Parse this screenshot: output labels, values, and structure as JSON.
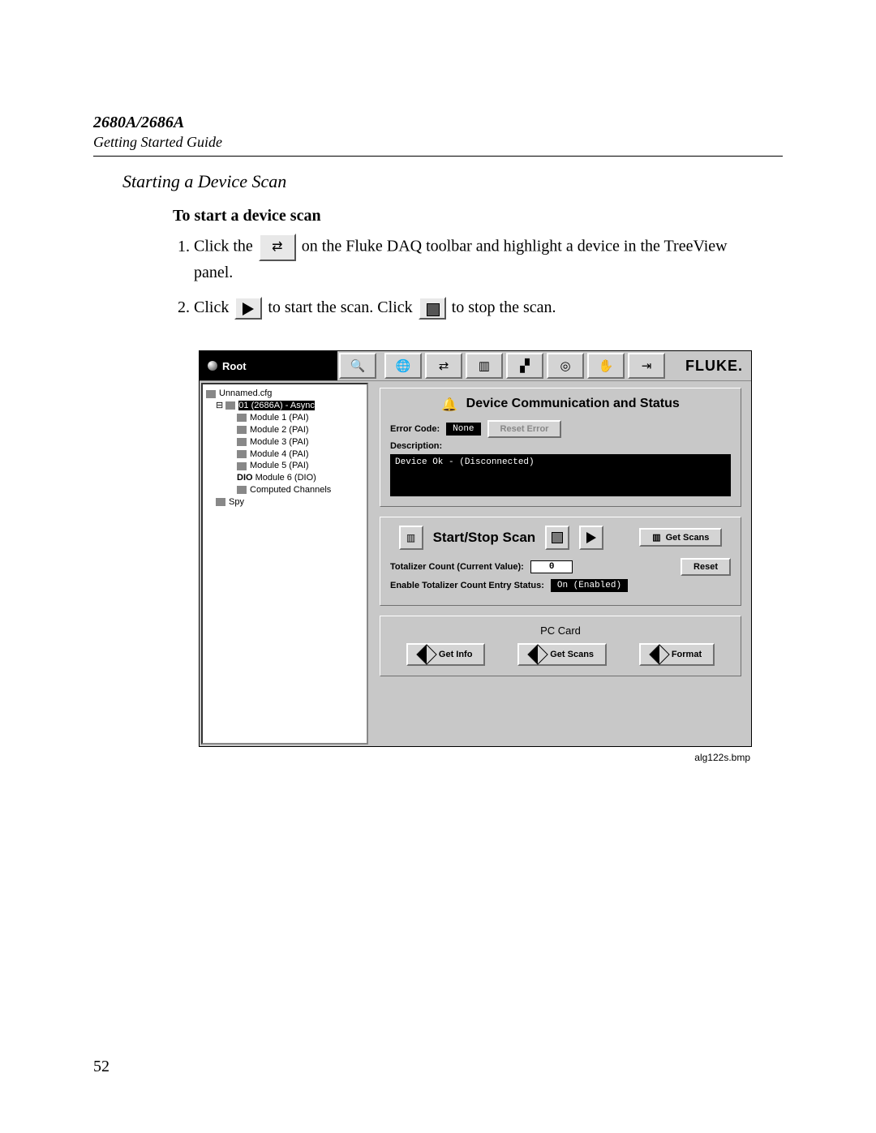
{
  "header": {
    "model": "2680A/2686A",
    "guide": "Getting Started Guide"
  },
  "section_title": "Starting a Device Scan",
  "subheading": "To start a device scan",
  "steps": {
    "s1a": "Click the ",
    "s1b": " on the Fluke DAQ toolbar and highlight a device in the TreeView panel.",
    "s2a": "Click ",
    "s2b": " to start the scan. Click ",
    "s2c": " to stop the scan."
  },
  "app": {
    "root_label": "Root",
    "logo": "FLUKE.",
    "toolbar_icons": [
      "search-icon",
      "globe-icon",
      "communication-icon",
      "device-icon",
      "chart-icon",
      "target-icon",
      "hand-icon",
      "exit-icon"
    ],
    "tree": {
      "cfg": "Unnamed.cfg",
      "dev": "01 (2686A) - Async",
      "modules": [
        "Module 1 (PAI)",
        "Module 2 (PAI)",
        "Module 3 (PAI)",
        "Module 4 (PAI)",
        "Module 5 (PAI)",
        "Module 6 (DIO)"
      ],
      "mod6_prefix": "DIO",
      "computed": "Computed Channels",
      "spy": "Spy"
    },
    "comm": {
      "title": "Device Communication and Status",
      "error_code_label": "Error Code:",
      "error_code_value": "None",
      "reset_error": "Reset Error",
      "description_label": "Description:",
      "description_text": "Device Ok -  (Disconnected)"
    },
    "scan": {
      "title": "Start/Stop Scan",
      "get_scans": "Get Scans",
      "totalizer_label": "Totalizer Count (Current Value):",
      "totalizer_value": "0",
      "reset": "Reset",
      "enable_label": "Enable Totalizer Count Entry Status:",
      "enable_value": "On (Enabled)"
    },
    "pccard": {
      "title": "PC Card",
      "get_info": "Get Info",
      "get_scans": "Get Scans",
      "format": "Format"
    }
  },
  "figure_caption": "alg122s.bmp",
  "page_number": "52"
}
